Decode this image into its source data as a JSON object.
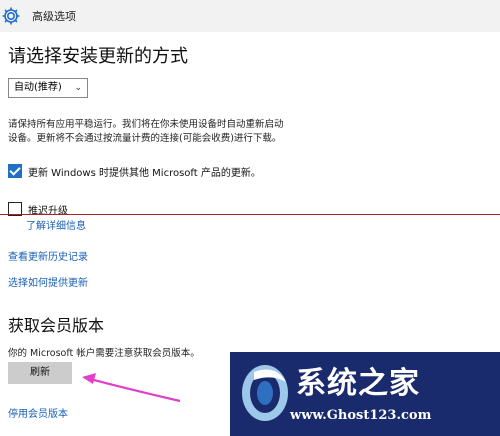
{
  "window": {
    "title": "高级选项",
    "icon": "gear-icon"
  },
  "section_update": {
    "heading": "请选择安装更新的方式",
    "mode_select": {
      "value": "自动(推荐)"
    },
    "description_line1": "请保持所有应用平稳运行。我们将在你未使用设备时自动重新启动",
    "description_line2": "设备。更新将不会通过按流量计费的连接(可能会收费)进行下载。",
    "option_microsoft": {
      "label": "更新 Windows 时提供其他 Microsoft 产品的更新。",
      "checked": true
    },
    "option_defer": {
      "label": "推迟升级",
      "checked": false
    },
    "links": {
      "learn_more": "了解详细信息",
      "history": "查看更新历史记录",
      "delivery": "选择如何提供更新"
    }
  },
  "section_insider": {
    "heading": "获取会员版本",
    "note": "你的 Microsoft 帐户需要注意获取会员版本。",
    "refresh_button": "刷新",
    "stop_link": "停用会员版本"
  },
  "watermark": {
    "text": "系统之家",
    "url": "www.Ghost123.com"
  },
  "colors": {
    "accent": "#1f6fc6",
    "link": "#1a5fb4",
    "arrow": "#e040c8",
    "watermark_bg": "#1a2b6d"
  }
}
